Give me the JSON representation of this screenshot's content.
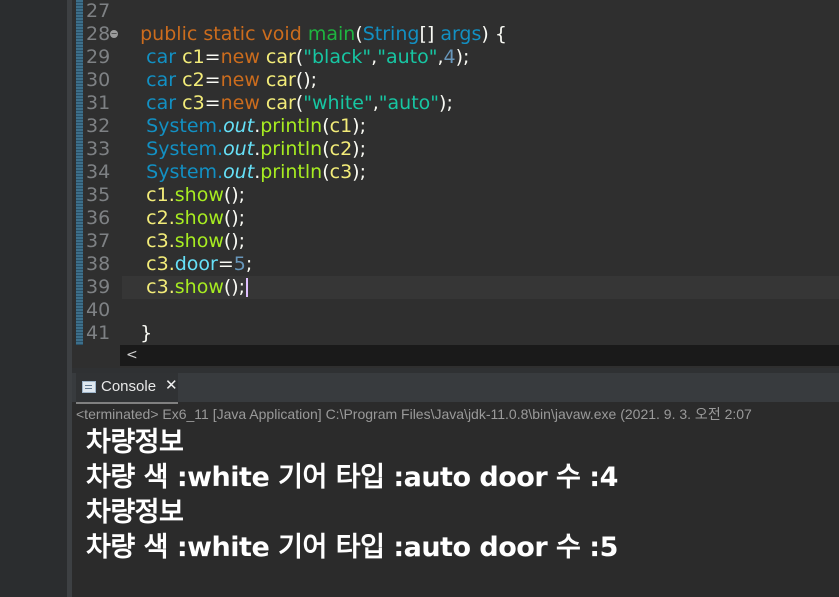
{
  "editor": {
    "line_numbers": [
      "27",
      "28",
      "29",
      "30",
      "31",
      "32",
      "33",
      "34",
      "35",
      "36",
      "37",
      "38",
      "39",
      "40",
      "41"
    ],
    "code": {
      "l28": {
        "kw1": "public",
        "kw2": "static",
        "kw3": "void",
        "name": "main",
        "p1": "(",
        "type": "String",
        "p2": "[] ",
        "arg": "args",
        "p3": ") {"
      },
      "l29": {
        "type": "car",
        "var": "c1",
        "eq": "=",
        "kw": "new",
        "cls": "car",
        "p1": "(",
        "s1": "\"black\"",
        "c1": ",",
        "s2": "\"auto\"",
        "c2": ",",
        "n": "4",
        "p2": ");"
      },
      "l30": {
        "type": "car",
        "var": "c2",
        "eq": "=",
        "kw": "new",
        "cls": "car",
        "p1": "();"
      },
      "l31": {
        "type": "car",
        "var": "c3",
        "eq": "=",
        "kw": "new",
        "cls": "car",
        "p1": "(",
        "s1": "\"white\"",
        "c1": ",",
        "s2": "\"auto\"",
        "p2": ");"
      },
      "l32": {
        "sys": "System.",
        "out": "out",
        "dot": ".",
        "m": "println",
        "p1": "(",
        "arg": "c1",
        "p2": ");"
      },
      "l33": {
        "sys": "System.",
        "out": "out",
        "dot": ".",
        "m": "println",
        "p1": "(",
        "arg": "c2",
        "p2": ");"
      },
      "l34": {
        "sys": "System.",
        "out": "out",
        "dot": ".",
        "m": "println",
        "p1": "(",
        "arg": "c3",
        "p2": ");"
      },
      "l35": {
        "obj": "c1.",
        "m": "show",
        "p": "();"
      },
      "l36": {
        "obj": "c2.",
        "m": "show",
        "p": "();"
      },
      "l37": {
        "obj": "c3.",
        "m": "show",
        "p": "();"
      },
      "l38": {
        "obj": "c3.",
        "f": "door",
        "eq": "=",
        "n": "5",
        "semi": ";"
      },
      "l39": {
        "obj": "c3.",
        "m": "show",
        "p": "();"
      },
      "l41": {
        "brace": "}"
      }
    },
    "scroll_left": "<"
  },
  "console": {
    "tab_label": "Console",
    "close": "✕",
    "status": "<terminated> Ex6_11 [Java Application] C:\\Program Files\\Java\\jdk-11.0.8\\bin\\javaw.exe  (2021. 9. 3. 오전 2:07",
    "output": [
      "차량정보",
      "차량 색 :white 기어 타입 :auto door 수 :4",
      "차량정보",
      "차량 색 :white 기어 타입 :auto door 수 :5"
    ]
  }
}
